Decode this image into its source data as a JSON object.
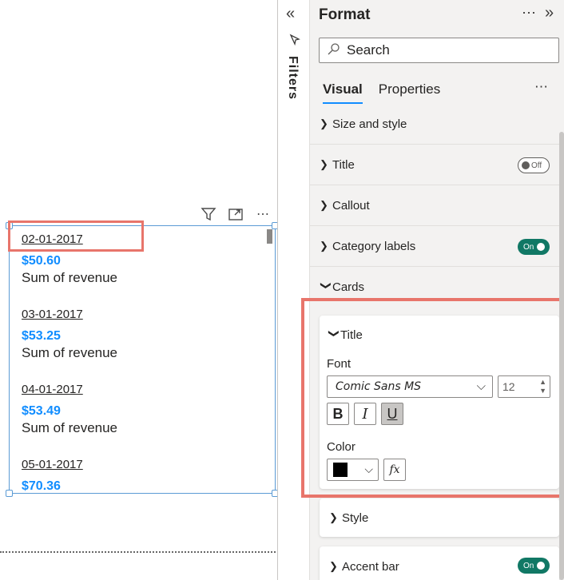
{
  "colors": {
    "accent": "#118dff",
    "highlight": "#e8756b",
    "toggle_on": "#117865",
    "selection_border": "#5b9bd5"
  },
  "visual": {
    "header_icons": [
      "filter-icon",
      "focus-mode-icon",
      "more-options-icon"
    ],
    "cards": [
      {
        "date": "02-01-2017",
        "value": "$50.60",
        "label": "Sum of revenue"
      },
      {
        "date": "03-01-2017",
        "value": "$53.25",
        "label": "Sum of revenue"
      },
      {
        "date": "04-01-2017",
        "value": "$53.49",
        "label": "Sum of revenue"
      },
      {
        "date": "05-01-2017",
        "value": "$70.36",
        "label": ""
      }
    ]
  },
  "filters_pane": {
    "label": "Filters"
  },
  "format_pane": {
    "title": "Format",
    "search_placeholder": "Search",
    "tabs": [
      {
        "label": "Visual",
        "active": true
      },
      {
        "label": "Properties",
        "active": false
      }
    ],
    "sections": {
      "size_and_style": "Size and style",
      "title": "Title",
      "title_toggle": "Off",
      "callout": "Callout",
      "category_labels": "Category labels",
      "category_labels_toggle": "On",
      "cards": "Cards"
    },
    "cards_title_group": {
      "heading": "Title",
      "font_label": "Font",
      "font_family": "Comic Sans MS",
      "font_size": "12",
      "bold": "B",
      "italic": "I",
      "underline": "U",
      "underline_active": true,
      "color_label": "Color",
      "color_value": "#000000",
      "fx_label": "fx"
    },
    "style_label": "Style",
    "accent_bar": "Accent bar",
    "accent_bar_toggle": "On"
  }
}
